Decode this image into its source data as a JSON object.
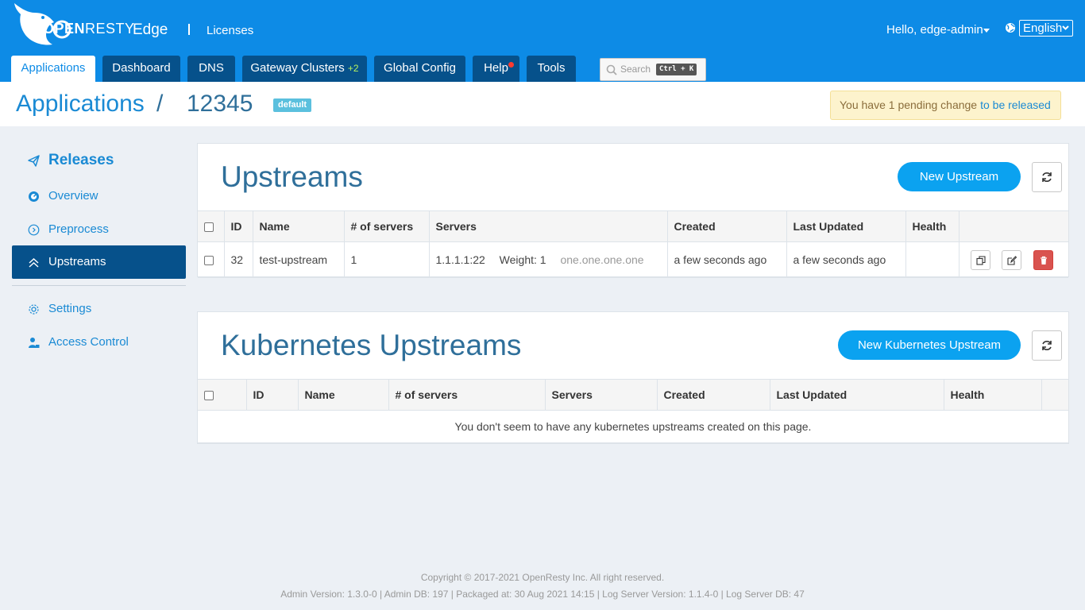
{
  "header": {
    "brand_open": "OPEN",
    "brand_resty": "RESTY",
    "brand_product": "Edge",
    "licenses": "Licenses",
    "greeting": "Hello, edge-admin",
    "language": "English"
  },
  "nav": {
    "tabs": [
      {
        "label": "Applications"
      },
      {
        "label": "Dashboard"
      },
      {
        "label": "DNS"
      },
      {
        "label": "Gateway Clusters",
        "extra": "+2"
      },
      {
        "label": "Global Config"
      },
      {
        "label": "Help"
      },
      {
        "label": "Tools"
      }
    ],
    "search_placeholder": "Search",
    "search_shortcut": "Ctrl + K"
  },
  "titlebar": {
    "app_crumb": "Applications",
    "separator": "/",
    "app_id": "12345",
    "badge": "default",
    "pending_text": "You have 1 pending change",
    "pending_link": "to be released"
  },
  "sidebar": {
    "items": [
      {
        "label": "Releases"
      },
      {
        "label": "Overview"
      },
      {
        "label": "Preprocess"
      },
      {
        "label": "Upstreams"
      },
      {
        "label": "Settings"
      },
      {
        "label": "Access Control"
      }
    ]
  },
  "upstreams": {
    "title": "Upstreams",
    "new_button": "New Upstream",
    "columns": [
      "ID",
      "Name",
      "# of servers",
      "Servers",
      "Created",
      "Last Updated",
      "Health"
    ],
    "rows": [
      {
        "id": "32",
        "name": "test-upstream",
        "num_servers": "1",
        "server_addr": "1.1.1.1:22",
        "server_weight": "Weight: 1",
        "server_host": "one.one.one.one",
        "created": "a few seconds ago",
        "updated": "a few seconds ago",
        "health": ""
      }
    ]
  },
  "k8s": {
    "title": "Kubernetes Upstreams",
    "new_button": "New Kubernetes Upstream",
    "columns": [
      "ID",
      "Name",
      "# of servers",
      "Servers",
      "Created",
      "Last Updated",
      "Health"
    ],
    "empty_message": "You don't seem to have any kubernetes upstreams created on this page."
  },
  "footer": {
    "copyright": "Copyright © 2017-2021 OpenResty Inc. All right reserved.",
    "versions": "Admin Version: 1.3.0-0  |  Admin DB: 197  |  Packaged at: 30 Aug 2021 14:15  |  Log Server Version: 1.1.4-0  |  Log Server DB: 47"
  },
  "colors": {
    "header_bg": "#0d8be6",
    "nav_tab_bg": "#06518b",
    "accent": "#1a8ad4",
    "primary_button": "#0ba2f0",
    "danger": "#d9534f"
  }
}
